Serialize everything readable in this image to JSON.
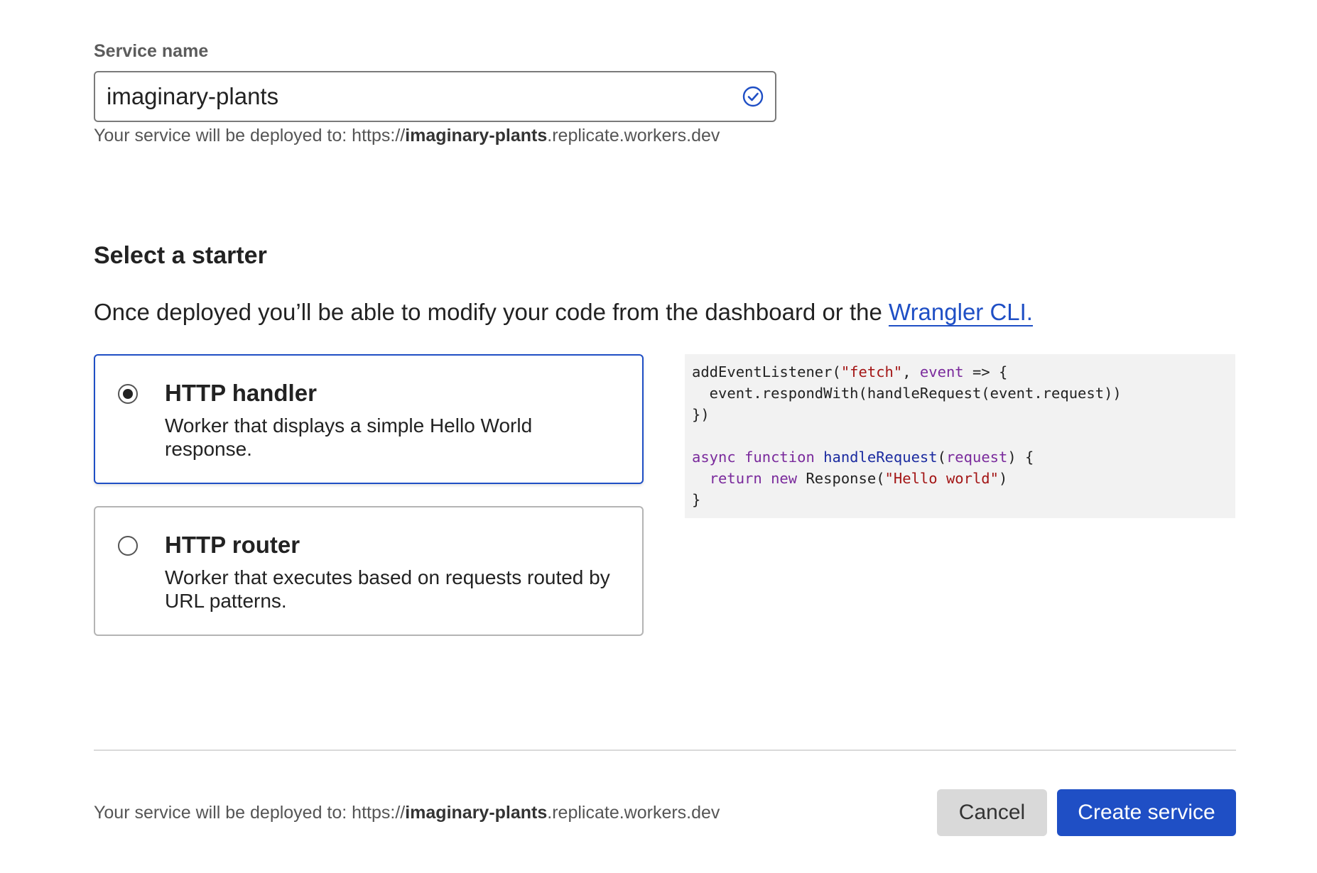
{
  "service_name": {
    "label": "Service name",
    "value": "imaginary-plants",
    "status_icon": "check-circle-icon",
    "deploy_prefix": "Your service will be deployed to: https://",
    "deploy_name": "imaginary-plants",
    "deploy_suffix": ".replicate.workers.dev"
  },
  "starter": {
    "heading": "Select a starter",
    "description": "Once deployed you’ll be able to modify your code from the dashboard or the ",
    "link_text": "Wrangler CLI.",
    "options": [
      {
        "title": "HTTP handler",
        "description": "Worker that displays a simple Hello World response.",
        "selected": true
      },
      {
        "title": "HTTP router",
        "description": "Worker that executes based on requests routed by URL patterns.",
        "selected": false
      }
    ],
    "code_lines": [
      [
        {
          "t": "addEventListener(",
          "c": ""
        },
        {
          "t": "\"fetch\"",
          "c": "str"
        },
        {
          "t": ", ",
          "c": ""
        },
        {
          "t": "event",
          "c": "kw"
        },
        {
          "t": " => {",
          "c": ""
        }
      ],
      [
        {
          "t": "  event.respondWith(handleRequest(event.request))",
          "c": ""
        }
      ],
      [
        {
          "t": "})",
          "c": ""
        }
      ],
      [
        {
          "t": "",
          "c": ""
        }
      ],
      [
        {
          "t": "async",
          "c": "kw"
        },
        {
          "t": " ",
          "c": ""
        },
        {
          "t": "function",
          "c": "kw"
        },
        {
          "t": " ",
          "c": ""
        },
        {
          "t": "handleRequest",
          "c": "fn"
        },
        {
          "t": "(",
          "c": ""
        },
        {
          "t": "request",
          "c": "kw"
        },
        {
          "t": ") {",
          "c": ""
        }
      ],
      [
        {
          "t": "  ",
          "c": ""
        },
        {
          "t": "return",
          "c": "kw"
        },
        {
          "t": " ",
          "c": ""
        },
        {
          "t": "new",
          "c": "kw"
        },
        {
          "t": " Response(",
          "c": ""
        },
        {
          "t": "\"Hello world\"",
          "c": "str"
        },
        {
          "t": ")",
          "c": ""
        }
      ],
      [
        {
          "t": "}",
          "c": ""
        }
      ]
    ]
  },
  "footer": {
    "deploy_prefix": "Your service will be deployed to: https://",
    "deploy_name": "imaginary-plants",
    "deploy_suffix": ".replicate.workers.dev",
    "cancel_label": "Cancel",
    "create_label": "Create service"
  },
  "colors": {
    "accent": "#1f4fc5",
    "cancel_bg": "#d9d9d9",
    "code_bg": "#f2f2f2"
  }
}
